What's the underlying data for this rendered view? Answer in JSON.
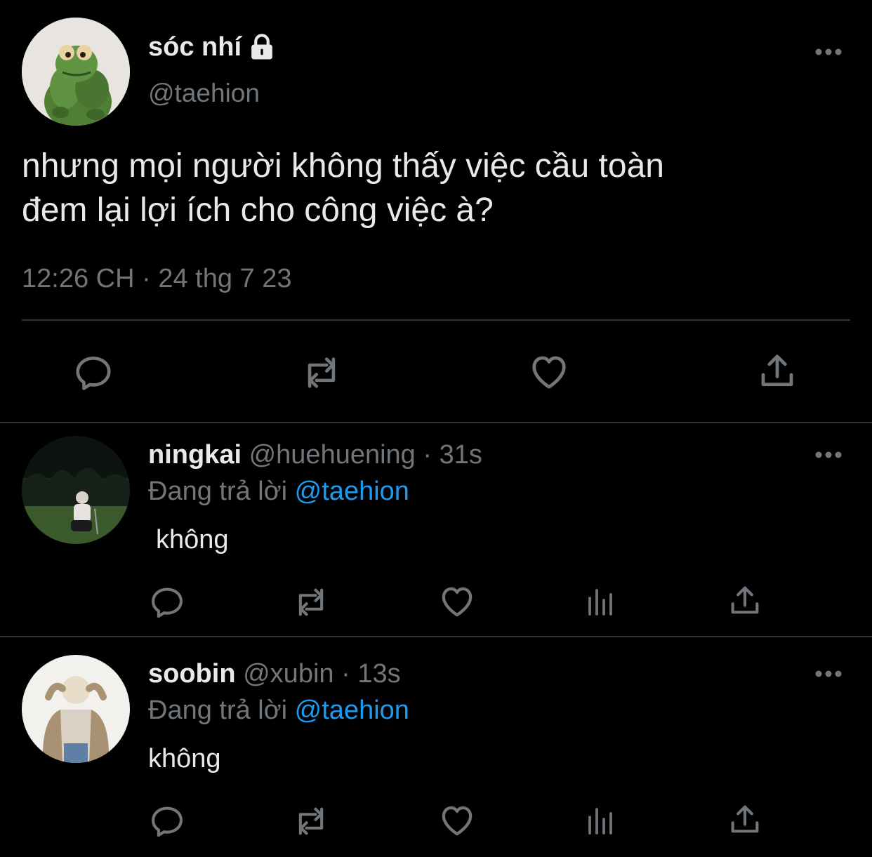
{
  "main_tweet": {
    "name": "sóc nhí",
    "handle": "@taehion",
    "text_line1": "nhưng mọi người không thấy việc cầu toàn",
    "text_line2": "đem lại lợi ích cho công việc à?",
    "time": "12:26 CH",
    "separator": "·",
    "date": "24 thg 7 23",
    "actions": [
      "reply-icon",
      "retweet-icon",
      "like-icon",
      "share-icon"
    ]
  },
  "replies": [
    {
      "name": "ningkai",
      "handle": "@huehuening",
      "separator": "·",
      "age": "31s",
      "replying_prefix": "Đang trả lời",
      "replying_to": "@taehion",
      "text": "không",
      "actions": [
        "reply-icon",
        "retweet-icon",
        "like-icon",
        "analytics-icon",
        "share-icon"
      ]
    },
    {
      "name": "soobin",
      "handle": "@xubin",
      "separator": "·",
      "age": "13s",
      "replying_prefix": "Đang trả lời",
      "replying_to": "@taehion",
      "text": "không",
      "actions": [
        "reply-icon",
        "retweet-icon",
        "like-icon",
        "analytics-icon",
        "share-icon"
      ]
    }
  ],
  "colors": {
    "background": "#000000",
    "text": "#e7e9ea",
    "secondary": "#71767b",
    "mention": "#1d9bf0",
    "divider": "#2f3336"
  }
}
